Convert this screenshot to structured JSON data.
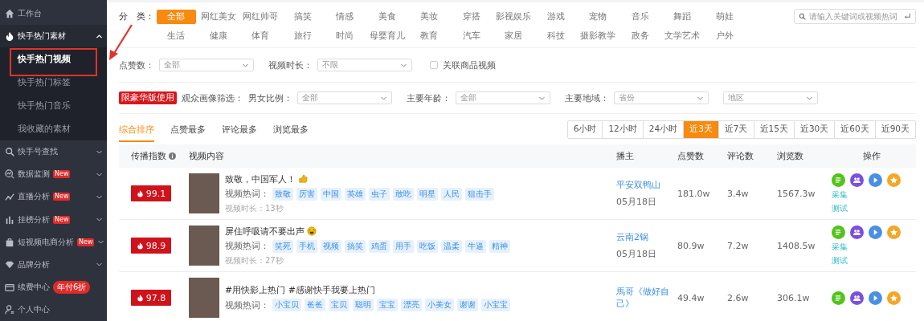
{
  "sidebar": {
    "items": [
      {
        "label": "工作台"
      },
      {
        "label": "快手热门素材",
        "expanded": true,
        "children": [
          {
            "label": "快手热门视频",
            "selected": true
          },
          {
            "label": "快手热门标签",
            "selected": false
          },
          {
            "label": "快手热门音乐",
            "selected": false
          },
          {
            "label": "我收藏的素材",
            "selected": false
          }
        ]
      },
      {
        "label": "快手号查找",
        "expanded": false
      },
      {
        "label": "数据监测",
        "expanded": false,
        "badge": {
          "text": "New",
          "kind": "tag"
        }
      },
      {
        "label": "直播分析",
        "expanded": false,
        "badge": {
          "text": "New",
          "kind": "tag"
        }
      },
      {
        "label": "挂榜分析",
        "expanded": false,
        "badge": {
          "text": "New",
          "kind": "tag"
        }
      },
      {
        "label": "短视频电商分析",
        "expanded": false,
        "badge": {
          "text": "New",
          "kind": "tag"
        }
      },
      {
        "label": "品牌分析",
        "expanded": false
      },
      {
        "label": "续费中心",
        "badge": {
          "text": "年付6折",
          "kind": "pill"
        }
      },
      {
        "label": "个人中心"
      }
    ]
  },
  "categories": {
    "label": "分　类：",
    "items": [
      {
        "label": "全部",
        "selected": true
      },
      {
        "label": "网红美女",
        "selected": false
      },
      {
        "label": "网红帅哥",
        "selected": false
      },
      {
        "label": "搞笑",
        "selected": false
      },
      {
        "label": "情感",
        "selected": false
      },
      {
        "label": "美食",
        "selected": false
      },
      {
        "label": "美妆",
        "selected": false
      },
      {
        "label": "穿搭",
        "selected": false
      },
      {
        "label": "影视娱乐",
        "selected": false
      },
      {
        "label": "游戏",
        "selected": false
      },
      {
        "label": "宠物",
        "selected": false
      },
      {
        "label": "音乐",
        "selected": false
      },
      {
        "label": "舞蹈",
        "selected": false
      },
      {
        "label": "萌娃",
        "selected": false
      },
      {
        "label": "生活",
        "selected": false
      },
      {
        "label": "健康",
        "selected": false
      },
      {
        "label": "体育",
        "selected": false
      },
      {
        "label": "旅行",
        "selected": false
      },
      {
        "label": "时尚",
        "selected": false
      },
      {
        "label": "母婴育儿",
        "selected": false
      },
      {
        "label": "教育",
        "selected": false
      },
      {
        "label": "汽车",
        "selected": false
      },
      {
        "label": "家居",
        "selected": false
      },
      {
        "label": "科技",
        "selected": false
      },
      {
        "label": "摄影教学",
        "selected": false
      },
      {
        "label": "政务",
        "selected": false
      },
      {
        "label": "文学艺术",
        "selected": false
      },
      {
        "label": "户外",
        "selected": false
      }
    ],
    "search": {
      "placeholder": "请输入关键词或视频热词"
    }
  },
  "filters": [
    {
      "label": "点赞数：",
      "value": "全部"
    },
    {
      "label": "视频时长：",
      "value": "不限"
    }
  ],
  "related_goods": {
    "label": "关联商品视频",
    "checked": false
  },
  "audience": {
    "badge": "限豪华版使用",
    "label": "观众画像筛选：",
    "filters": [
      {
        "label": "男女比例：",
        "value": "全部"
      },
      {
        "label": "主要年龄：",
        "value": "全部"
      },
      {
        "label": "主要地域：",
        "value": "省份"
      },
      {
        "value": "地区"
      }
    ]
  },
  "sort_tabs": [
    {
      "label": "综合排序",
      "selected": true
    },
    {
      "label": "点赞最多",
      "selected": false
    },
    {
      "label": "评论最多",
      "selected": false
    },
    {
      "label": "浏览最多",
      "selected": false
    }
  ],
  "time_ranges": [
    {
      "label": "6小时",
      "selected": false
    },
    {
      "label": "12小时",
      "selected": false
    },
    {
      "label": "24小时",
      "selected": false
    },
    {
      "label": "近3天",
      "selected": true
    },
    {
      "label": "近7天",
      "selected": false
    },
    {
      "label": "近15天",
      "selected": false
    },
    {
      "label": "近30天",
      "selected": false
    },
    {
      "label": "近60天",
      "selected": false
    },
    {
      "label": "近90天",
      "selected": false
    }
  ],
  "table": {
    "columns": [
      "传播指数",
      "视频内容",
      "播主",
      "点赞数",
      "评论数",
      "浏览数",
      "操作"
    ],
    "rows": [
      {
        "index": "99.1",
        "title": "致敬，中国军人！",
        "tags_label": "视频热词：",
        "tags": [
          "致敬",
          "厉害",
          "中国",
          "英雄",
          "虫子",
          "敢吃",
          "明星",
          "人民",
          "狙击手"
        ],
        "duration": "视频时长：13秒",
        "host": "平安双鸭山",
        "date": "05月18日",
        "likes": "181.0w",
        "comments": "3.4w",
        "views": "1567.3w",
        "links": [
          "采集",
          "测试"
        ]
      },
      {
        "index": "98.9",
        "title": "屏住呼吸请不要出声",
        "tags_label": "视频热词：",
        "tags": [
          "笑死",
          "手机",
          "视频",
          "搞笑",
          "鸡蛋",
          "用手",
          "吃饭",
          "温柔",
          "牛逼",
          "精神"
        ],
        "duration": "视频时长：27秒",
        "host": "云南2锅",
        "date": "05月18日",
        "likes": "80.9w",
        "comments": "7.2w",
        "views": "1408.5w",
        "links": [
          "采集",
          "测试"
        ]
      },
      {
        "index": "97.8",
        "title": "#用快影上热门 #感谢快手我要上热门",
        "tags_label": "视频热词：",
        "tags": [
          "小宝贝",
          "爸爸",
          "宝贝",
          "聪明",
          "宝宝",
          "漂亮",
          "小美女",
          "谢谢",
          "小宝宝"
        ],
        "host": "馬哥《做好自己》",
        "likes": "49.4w",
        "comments": "2.6w",
        "views": "306.1w",
        "links": []
      }
    ]
  }
}
